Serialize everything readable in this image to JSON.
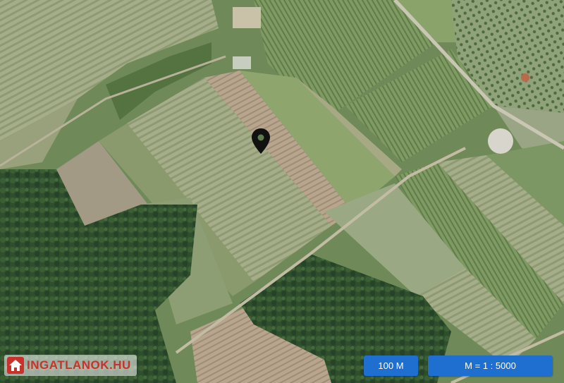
{
  "brand": {
    "logo_text": "INGATLANOK.HU",
    "logo_color": "#c8322a",
    "logo_icon": "house-icon"
  },
  "map": {
    "type": "satellite",
    "marker_icon": "location-pin-icon",
    "marker_color": "#111111"
  },
  "controls": {
    "scale_bar_label": "100 M",
    "scale_ratio_label": "M = 1 : 5000",
    "button_color": "#1f6fd1"
  }
}
